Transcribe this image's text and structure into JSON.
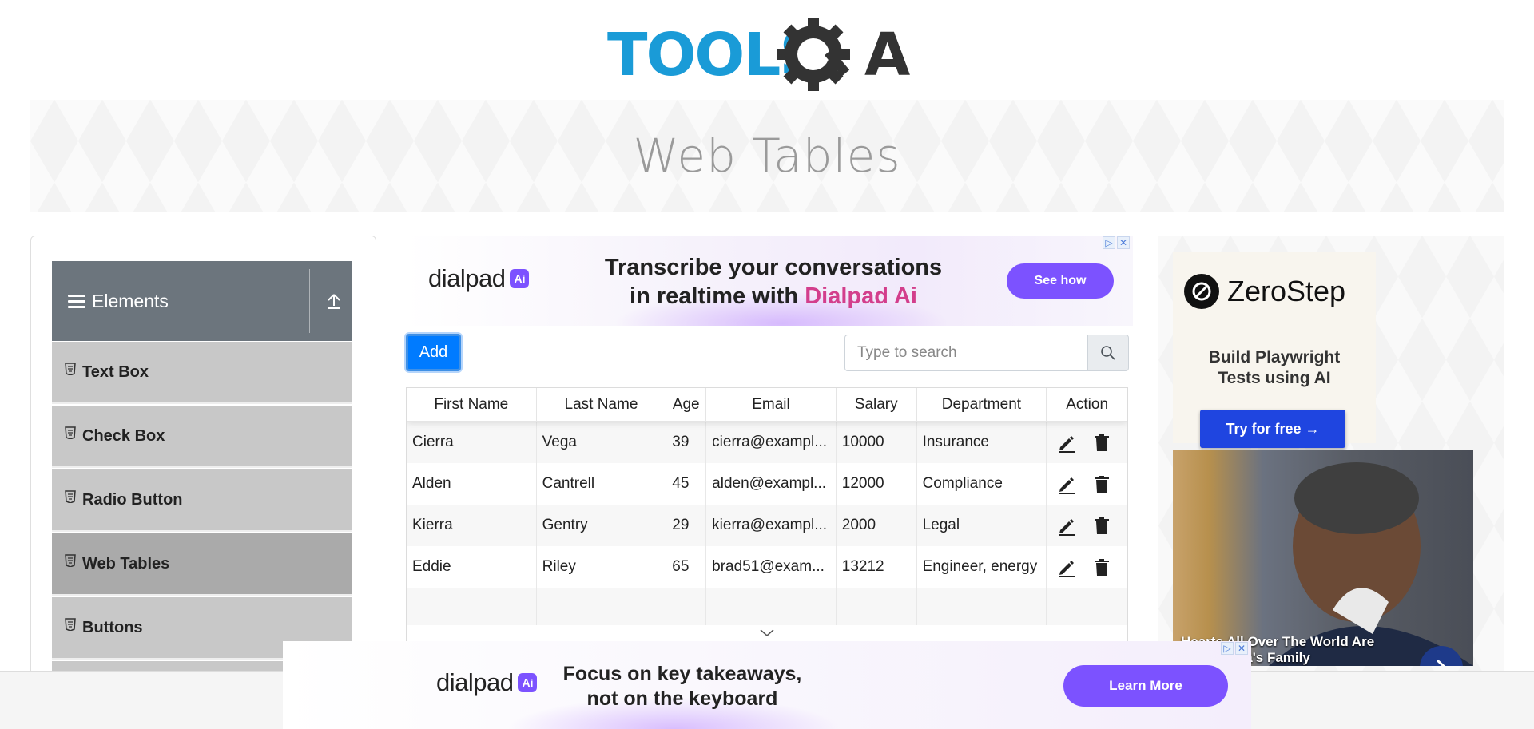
{
  "logo": {
    "text_left": "TOOLS",
    "text_right": "A",
    "colors": {
      "blue": "#1a9bd7",
      "dark": "#333333"
    }
  },
  "banner": {
    "title": "Web Tables"
  },
  "sidebar": {
    "group_title": "Elements",
    "items": [
      {
        "label": "Text Box"
      },
      {
        "label": "Check Box"
      },
      {
        "label": "Radio Button"
      },
      {
        "label": "Web Tables",
        "active": true
      },
      {
        "label": "Buttons"
      }
    ]
  },
  "ad_top": {
    "brand": "dialpad",
    "brand_badge": "Ai",
    "headline_1": "Transcribe your conversations",
    "headline_2a": "in realtime with ",
    "headline_2b": "Dialpad Ai",
    "cta": "See how"
  },
  "controls": {
    "add_label": "Add",
    "search_placeholder": "Type to search"
  },
  "table": {
    "headers": [
      "First Name",
      "Last Name",
      "Age",
      "Email",
      "Salary",
      "Department",
      "Action"
    ],
    "rows": [
      [
        "Cierra",
        "Vega",
        "39",
        "cierra@exampl...",
        "10000",
        "Insurance"
      ],
      [
        "Alden",
        "Cantrell",
        "45",
        "alden@exampl...",
        "12000",
        "Compliance"
      ],
      [
        "Kierra",
        "Gentry",
        "29",
        "kierra@exampl...",
        "2000",
        "Legal"
      ],
      [
        "Eddie",
        "Riley",
        "65",
        "brad51@exam...",
        "13212",
        "Engineer, energy"
      ]
    ]
  },
  "ad_right": {
    "brand": "ZeroStep",
    "subtitle_1": "Build Playwright",
    "subtitle_2": "Tests using AI",
    "cta": "Try for free →",
    "caption_1": "Hearts All Over The World Are",
    "caption_2": "For Obama's Family"
  },
  "ad_bottom": {
    "brand": "dialpad",
    "brand_badge": "Ai",
    "headline_1": "Focus on key takeaways,",
    "headline_2": "not on the keyboard",
    "cta": "Learn More"
  },
  "colors": {
    "accent": "#007bff",
    "sidebar_header": "#6c757d",
    "ad_purple": "#7c52ff"
  }
}
